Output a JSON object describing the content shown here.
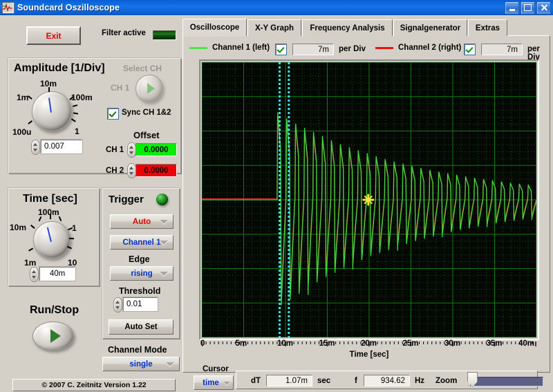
{
  "window": {
    "title": "Soundcard Oszilloscope",
    "minimize_label": "minimize",
    "maximize_label": "maximize",
    "close_label": "close"
  },
  "left_panel": {
    "exit_label": "Exit",
    "filter_label": "Filter active",
    "amplitude": {
      "title": "Amplitude [1/Div]",
      "knob_ticks": [
        "100u",
        "1m",
        "10m",
        "100m",
        "1"
      ],
      "value": "0.007"
    },
    "select_ch": {
      "title": "Select CH",
      "channel_label": "CH 1"
    },
    "sync_label": "Sync CH 1&2",
    "sync_checked": true,
    "offset": {
      "title": "Offset",
      "ch1_label": "CH 1",
      "ch1_value": "0.0000",
      "ch1_color": "#00ee00",
      "ch2_label": "CH 2",
      "ch2_value": "0.0000",
      "ch2_color": "#ee0000"
    },
    "time": {
      "title": "Time [sec]",
      "knob_ticks": [
        "1m",
        "10m",
        "100m",
        "1",
        "10"
      ],
      "value": "40m"
    },
    "trigger": {
      "title": "Trigger",
      "mode": "Auto",
      "mode_color": "#e00000",
      "source": "Channel 1",
      "source_color": "#0033cc",
      "edge_label": "Edge",
      "edge": "rising",
      "edge_color": "#0033cc",
      "threshold_label": "Threshold",
      "threshold": "0.01",
      "autoset_label": "Auto Set"
    },
    "run_stop_label": "Run/Stop",
    "channel_mode": {
      "label": "Channel Mode",
      "value": "single",
      "value_color": "#0033cc"
    },
    "copyright": "© 2007   C. Zeitnitz Version 1.22"
  },
  "tabs": [
    {
      "label": "Oscilloscope",
      "active": true
    },
    {
      "label": "X-Y Graph",
      "active": false
    },
    {
      "label": "Frequency Analysis",
      "active": false
    },
    {
      "label": "Signalgenerator",
      "active": false
    },
    {
      "label": "Extras",
      "active": false
    }
  ],
  "channels": [
    {
      "name": "Channel 1 (left)",
      "color": "#4ee44e",
      "enabled": true,
      "per_div_value": "7m",
      "per_div_label": "per Div"
    },
    {
      "name": "Channel 2 (right)",
      "color": "#ee1111",
      "enabled": true,
      "per_div_value": "7m",
      "per_div_label": "per Div"
    }
  ],
  "cursor": {
    "label": "Cursor",
    "mode": "time",
    "mode_color": "#0033cc",
    "dt_label": "dT",
    "dt_value": "1.07m",
    "dt_unit": "sec",
    "f_label": "f",
    "f_value": "934.62",
    "f_unit": "Hz",
    "zoom_label": "Zoom",
    "zoom_position": 0
  },
  "chart_data": {
    "type": "line",
    "title": "",
    "xlabel": "Time [sec]",
    "ylabel": "",
    "xlim": [
      0,
      0.04
    ],
    "xtick_labels": [
      "0",
      "5m",
      "10m",
      "15m",
      "20m",
      "25m",
      "30m",
      "35m",
      "40m"
    ],
    "xtick_values": [
      0,
      0.005,
      0.01,
      0.015,
      0.02,
      0.025,
      0.03,
      0.035,
      0.04
    ],
    "ylim": [
      -4,
      4
    ],
    "grid": true,
    "grid_color": "#0f7a0f",
    "background": "#030803",
    "divisions_x": 8,
    "divisions_y": 8,
    "series": [
      {
        "name": "Channel 1 (left)",
        "color": "#3dd93d",
        "per_div": "7m"
      },
      {
        "name": "Channel 2 (right)",
        "color": "#d42a1a",
        "per_div": "7m"
      }
    ],
    "waveform": {
      "description": "Decaying damped pulse train (plucked string / percussive transient). Flat baseline until onset at ~9.0 ms, then a burst of narrow bipolar spikes with exponentially decaying envelope out to 40 ms.",
      "onset_time": 0.009,
      "pulse_period": 0.00107,
      "pulse_frequency": 934.62,
      "baseline": 0.0,
      "peak_initial": 2.55,
      "peak_final": 0.55,
      "trough_initial": -3.6,
      "trough_final": -0.35,
      "decay_tau": 0.017
    },
    "cursors": {
      "vertical_color": "#35e8e8",
      "vertical_times": [
        0.0093,
        0.0104
      ],
      "marker_color": "#f2e63a",
      "marker_time": 0.0199,
      "marker_value": 0.0
    }
  }
}
